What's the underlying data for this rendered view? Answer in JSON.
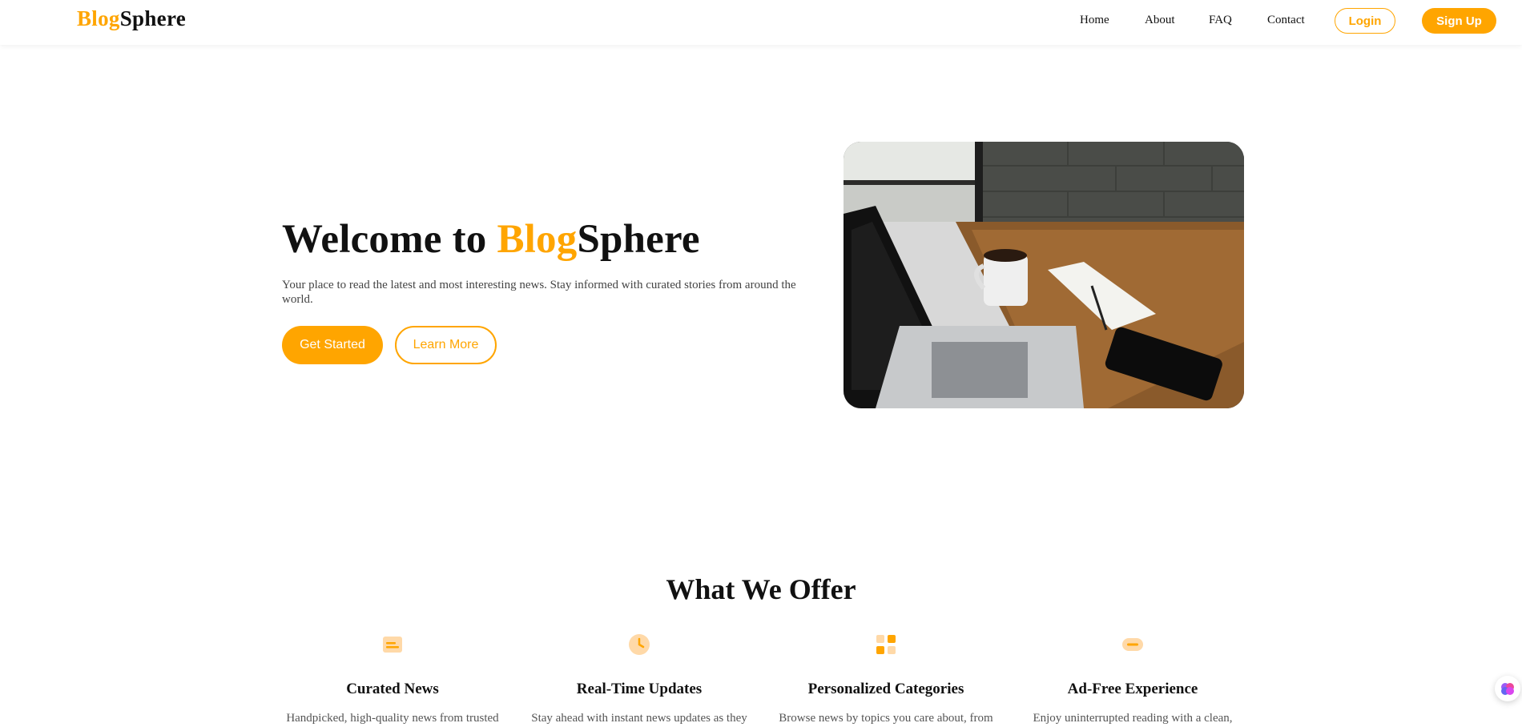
{
  "header": {
    "logo_part1": "Blog",
    "logo_part2": "Sphere",
    "nav": [
      "Home",
      "About",
      "FAQ",
      "Contact"
    ],
    "login_label": "Login",
    "signup_label": "Sign Up"
  },
  "hero": {
    "title_prefix": "Welcome to ",
    "title_accent": "Blog",
    "title_suffix": "Sphere",
    "subtitle": "Your place to read the latest and most interesting news. Stay informed with curated stories from around the world.",
    "primary_button": "Get Started",
    "secondary_button": "Learn More"
  },
  "offer": {
    "title": "What We Offer",
    "cards": [
      {
        "icon": "news-icon",
        "title": "Curated News",
        "text": "Handpicked, high-quality news from trusted"
      },
      {
        "icon": "clock-icon",
        "title": "Real-Time Updates",
        "text": "Stay ahead with instant news updates as they"
      },
      {
        "icon": "grid-icon",
        "title": "Personalized Categories",
        "text": "Browse news by topics you care about, from"
      },
      {
        "icon": "minus-icon",
        "title": "Ad-Free Experience",
        "text": "Enjoy uninterrupted reading with a clean,"
      }
    ]
  },
  "colors": {
    "accent": "#FFA500"
  }
}
